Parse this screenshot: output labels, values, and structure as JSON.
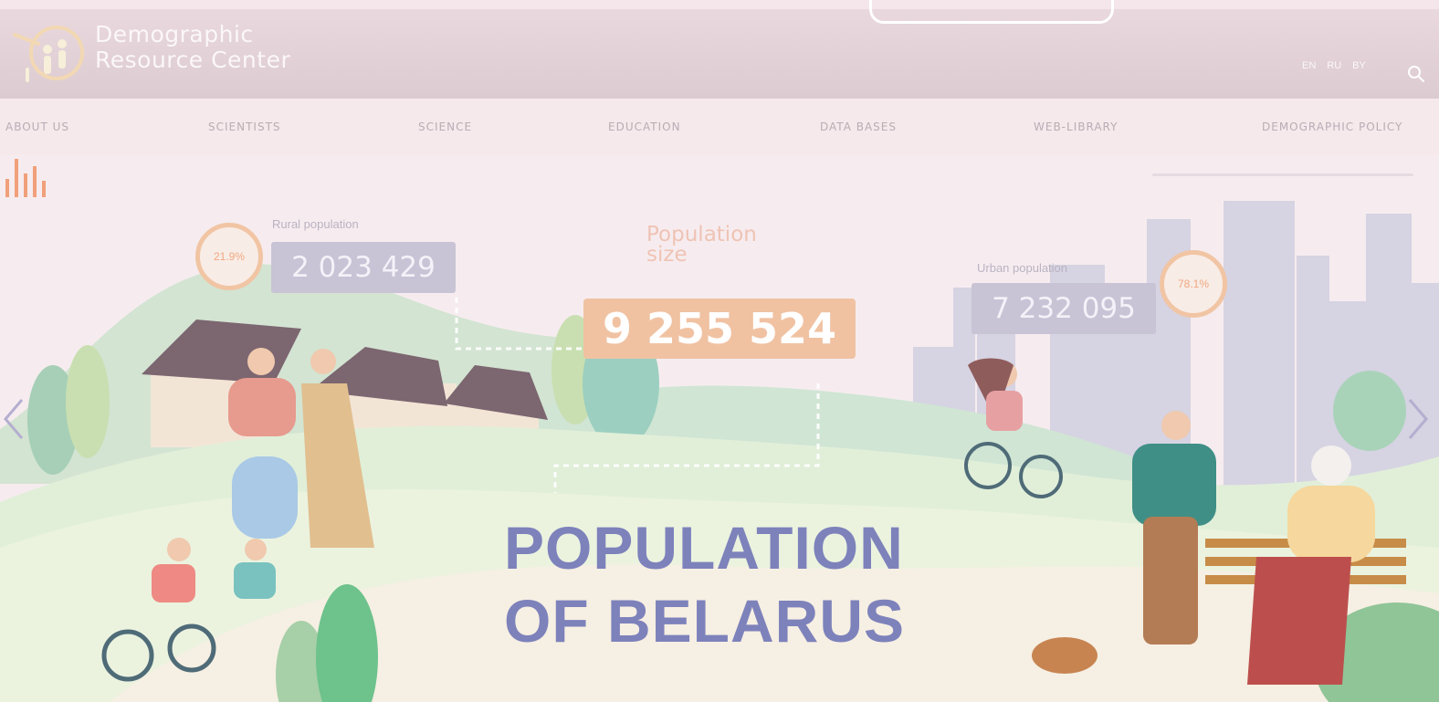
{
  "site": {
    "logo_line1": "Demographic",
    "logo_line2": "Resource Center",
    "logo_icon": "magnifier-people-logo"
  },
  "header": {
    "languages": [
      "EN",
      "RU",
      "BY"
    ],
    "search_icon": "search-icon"
  },
  "nav": {
    "items": [
      {
        "label": "ABOUT US"
      },
      {
        "label": "SCIENTISTS"
      },
      {
        "label": "SCIENCE"
      },
      {
        "label": "EDUCATION"
      },
      {
        "label": "DATA BASES"
      },
      {
        "label": "WEB-LIBRARY"
      },
      {
        "label": "DEMOGRAPHIC POLICY"
      }
    ]
  },
  "hero": {
    "rural": {
      "label": "Rural population",
      "value": "2 023 429",
      "percent": "21.9%"
    },
    "total": {
      "title_line1": "Population",
      "title_line2": "size",
      "value": "9 255 524"
    },
    "urban": {
      "label": "Urban population",
      "value": "7 232 095",
      "percent": "78.1%"
    },
    "headline_line1": "POPULATION",
    "headline_line2": "OF BELARUS",
    "prev_icon": "chevron-left-icon",
    "next_icon": "chevron-right-icon"
  },
  "colors": {
    "header": "#dccbd1",
    "nav": "#f5e9ec",
    "headline": "#7d82bb",
    "accent_orange": "#f0c2a2",
    "stat_box": "#c9c3d6"
  }
}
